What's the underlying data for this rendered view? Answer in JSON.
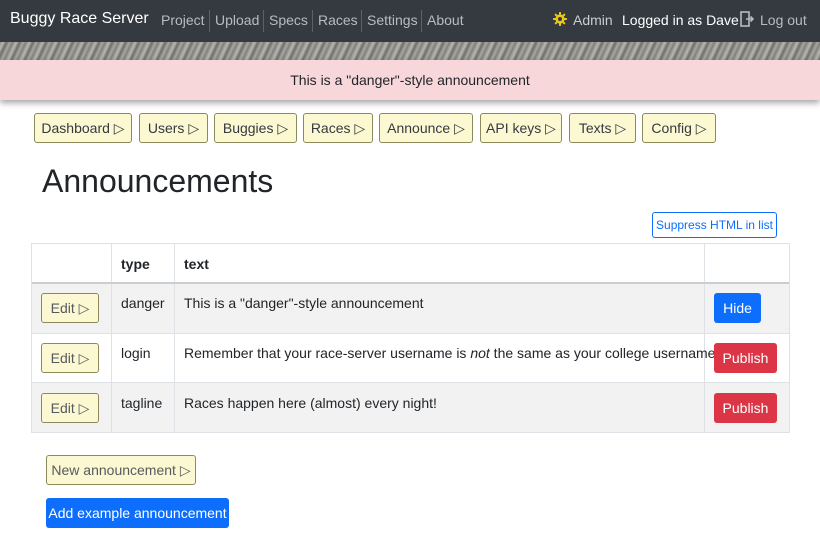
{
  "navbar": {
    "brand": "Buggy Race Server",
    "links": [
      "Project",
      "Upload",
      "Specs",
      "Races",
      "Settings",
      "About"
    ],
    "admin_label": "Admin",
    "logged_in_text": "Logged in as Dave",
    "logout_label": "Log out"
  },
  "banner": {
    "message": "This is a \"danger\"-style announcement"
  },
  "admin_nav": {
    "arrow": "▷",
    "buttons": [
      "Dashboard",
      "Users",
      "Buggies",
      "Races",
      "Announce",
      "API keys",
      "Texts",
      "Config"
    ]
  },
  "page": {
    "title": "Announcements",
    "suppress_label": "Suppress HTML in list"
  },
  "table": {
    "headers": {
      "type": "type",
      "text": "text"
    },
    "edit_label": "Edit ▷",
    "rows": [
      {
        "type": "danger",
        "text_plain": "This is a \"danger\"-style announcement",
        "action": "Hide"
      },
      {
        "type": "login",
        "text_before": "Remember that your race-server username is ",
        "text_em": "not",
        "text_after": " the same as your college username!",
        "action": "Publish"
      },
      {
        "type": "tagline",
        "text_plain": "Races happen here (almost) every night!",
        "action": "Publish"
      }
    ]
  },
  "footer_buttons": {
    "new_announcement": "New announcement ▷",
    "add_example": "Add example announcement"
  },
  "colors": {
    "navbar": "#343a40",
    "danger_banner": "#f8d7da",
    "admin_button": "#fcf8d2",
    "primary": "#0d6efd",
    "danger": "#dc3545"
  }
}
